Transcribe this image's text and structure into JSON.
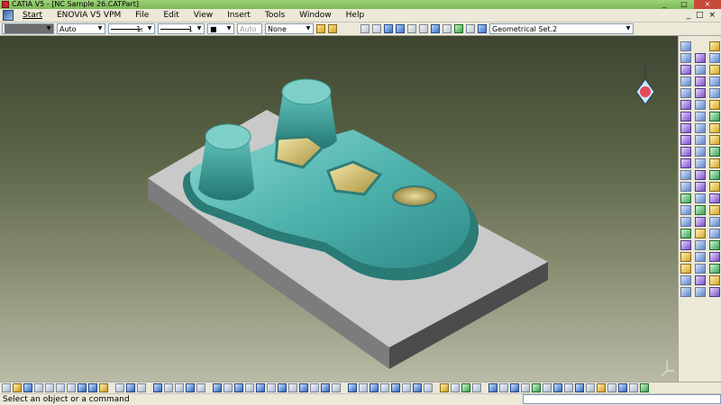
{
  "window": {
    "title": "CATIA V5 - [NC Sample 26.CATPart]",
    "minimize": "_",
    "restore": "□",
    "close": "×"
  },
  "menu": {
    "items": [
      "Start",
      "ENOVIA V5 VPM",
      "File",
      "Edit",
      "View",
      "Insert",
      "Tools",
      "Window",
      "Help"
    ],
    "right_controls": [
      "_",
      "□",
      "×"
    ]
  },
  "toolbar": {
    "color_value": "",
    "transparency_value": "Auto",
    "line_thickness_value": "1:",
    "line_type_value": "1",
    "point_value": "■",
    "layer_auto": "Auto",
    "layer_value": "None",
    "geometrical_set_value": "Geometrical Set.2",
    "dropdown_arrow": "▼"
  },
  "status": {
    "message": "Select an object or a command"
  },
  "colors": {
    "part_teal": "#4fb3ad",
    "block_gray": "#c9c9c9",
    "pocket_gold": "#c9b35a",
    "viewport_top": "#3e4631",
    "viewport_bottom": "#b9bba6"
  }
}
